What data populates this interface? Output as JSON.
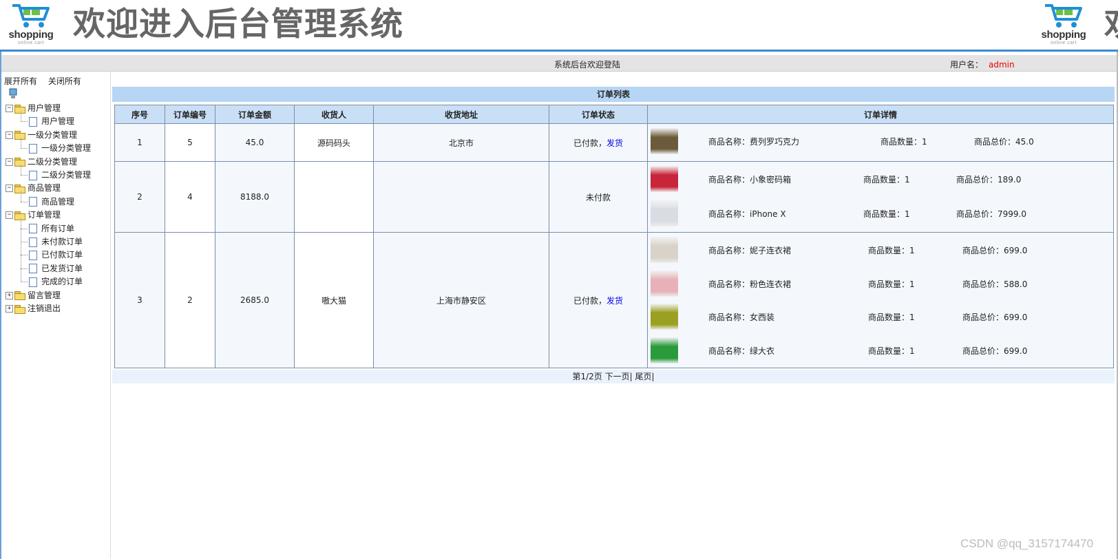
{
  "header": {
    "logo_word": "shopping",
    "logo_sub": "online cart",
    "welcome": "欢迎进入后台管理系统",
    "welcome_repeat": "欢"
  },
  "topbar": {
    "center": "系统后台欢迎登陆",
    "user_label": "用户名：",
    "user_name": "admin"
  },
  "sidebar": {
    "expand_all": "展开所有",
    "collapse_all": "关闭所有",
    "groups": [
      {
        "label": "用户管理",
        "children": [
          "用户管理"
        ]
      },
      {
        "label": "一级分类管理",
        "children": [
          "一级分类管理"
        ]
      },
      {
        "label": "二级分类管理",
        "children": [
          "二级分类管理"
        ]
      },
      {
        "label": "商品管理",
        "children": [
          "商品管理"
        ]
      },
      {
        "label": "订单管理",
        "children": [
          "所有订单",
          "未付款订单",
          "已付款订单",
          "已发货订单",
          "完成的订单"
        ]
      },
      {
        "label": "留言管理",
        "children": []
      },
      {
        "label": "注销退出",
        "children": []
      }
    ]
  },
  "table": {
    "title": "订单列表",
    "columns": [
      "序号",
      "订单编号",
      "订单金额",
      "收货人",
      "收货地址",
      "订单状态",
      "订单详情"
    ],
    "name_label": "商品名称：",
    "qty_label": "商品数量：",
    "total_label": "商品总价：",
    "rows": [
      {
        "index": "1",
        "order_no": "5",
        "amount": "45.0",
        "receiver": "源码码头",
        "address": "北京市",
        "status": "已付款，",
        "action": "发货",
        "items": [
          {
            "name": "费列罗巧克力",
            "qty": "1",
            "total": "45.0"
          }
        ]
      },
      {
        "index": "2",
        "order_no": "4",
        "amount": "8188.0",
        "receiver": "",
        "address": "",
        "status": "未付款",
        "action": "",
        "items": [
          {
            "name": "小象密码箱",
            "qty": "1",
            "total": "189.0"
          },
          {
            "name": "iPhone X",
            "qty": "1",
            "total": "7999.0"
          }
        ]
      },
      {
        "index": "3",
        "order_no": "2",
        "amount": "2685.0",
        "receiver": "嗷大猫",
        "address": "上海市静安区",
        "status": "已付款，",
        "action": "发货",
        "items": [
          {
            "name": "妮子连衣裙",
            "qty": "1",
            "total": "699.0"
          },
          {
            "name": "粉色连衣裙",
            "qty": "1",
            "total": "588.0"
          },
          {
            "name": "女西装",
            "qty": "1",
            "total": "699.0"
          },
          {
            "name": "绿大衣",
            "qty": "1",
            "total": "699.0"
          }
        ]
      }
    ]
  },
  "pager": {
    "text": "第1/2页",
    "next": "下一页|",
    "last": "尾页|"
  },
  "watermark": "CSDN @qq_3157174470"
}
